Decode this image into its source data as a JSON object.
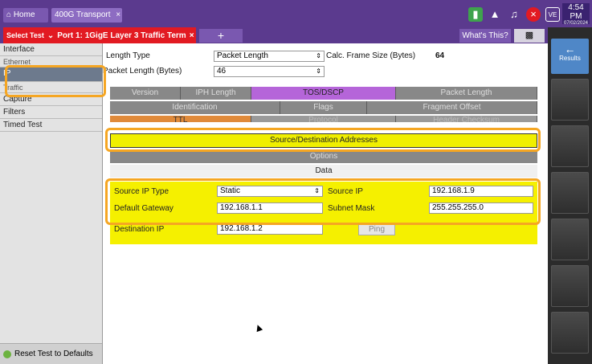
{
  "topbar": {
    "home_label": "Home",
    "tab_label": "400G Transport",
    "tab_close": "×",
    "clock_time": "4:54 PM",
    "clock_date": "07/02/2024",
    "status_icons": [
      "battery-charging-icon",
      "network-icon",
      "speaker-icon",
      "error-x-icon",
      "ve-icon"
    ]
  },
  "bar2": {
    "select_test_label": "Select Test",
    "test_name": "Port 1: 1GigE Layer 3 Traffic Term",
    "test_close": "×",
    "plus_label": "+",
    "whats_this": "What's This?"
  },
  "sidebar": {
    "items": [
      "Interface",
      "Ethernet",
      "IP",
      "Traffic",
      "Capture",
      "Filters",
      "Timed Test"
    ],
    "reset_label": "Reset Test to Defaults"
  },
  "rightrail": {
    "results_label": "Results"
  },
  "main": {
    "length_type_label": "Length Type",
    "length_type_value": "Packet Length",
    "calc_frame_label": "Calc. Frame Size (Bytes)",
    "calc_frame_value": "64",
    "packet_length_label": "Packet Length (Bytes)",
    "packet_length_value": "46",
    "row1": [
      "Version",
      "IPH Length",
      "TOS/DSCP",
      "Packet Length"
    ],
    "row2": [
      "Identification",
      "Flags",
      "Fragment Offset"
    ],
    "row3": [
      "TTL",
      "Protocol",
      "Header Checksum"
    ],
    "addr_row": "Source/Destination Addresses",
    "options_row": "Options",
    "data_row": "Data",
    "source_ip_type_label": "Source IP Type",
    "source_ip_type_value": "Static",
    "source_ip_label": "Source IP",
    "source_ip_value": "192.168.1.9",
    "default_gateway_label": "Default Gateway",
    "default_gateway_value": "192.168.1.1",
    "subnet_mask_label": "Subnet Mask",
    "subnet_mask_value": "255.255.255.0",
    "destination_ip_label": "Destination IP",
    "destination_ip_value": "192.168.1.2",
    "ping_label": "Ping"
  },
  "colors": {
    "header_purple": "#5b3a8e",
    "select_red": "#e21a22",
    "tos_selected": "#b565d9",
    "ttl_orange": "#e08a3a",
    "yellow_highlight": "#f5f000",
    "callout_orange": "#f5a623",
    "results_blue": "#4f87c7"
  }
}
